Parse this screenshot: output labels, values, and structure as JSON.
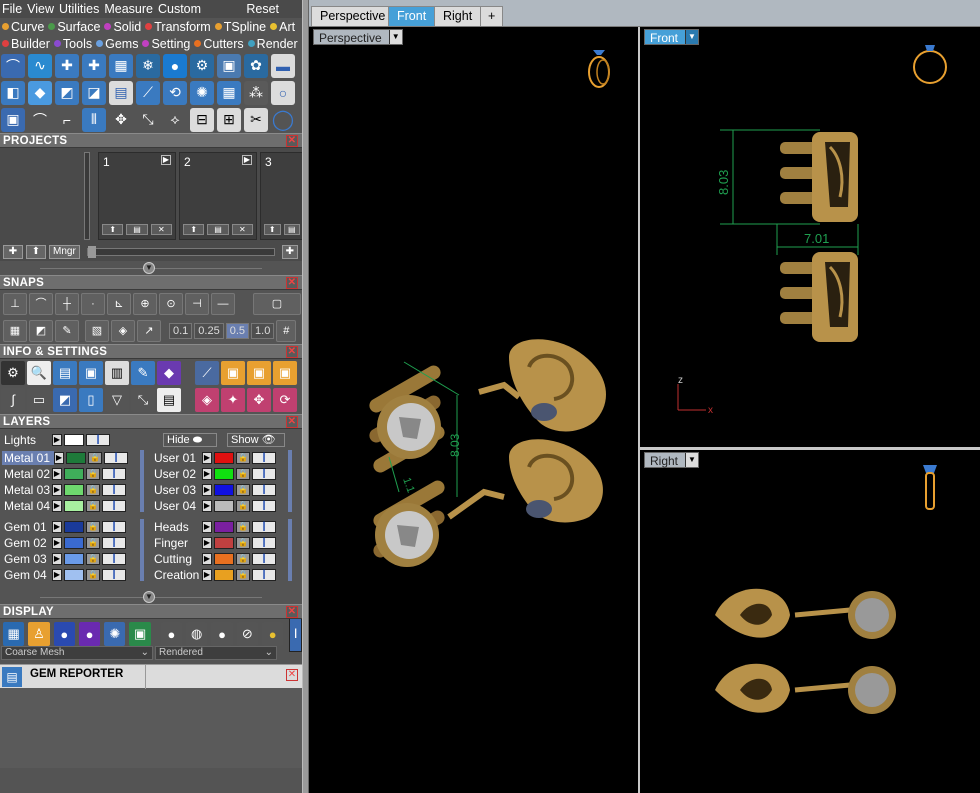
{
  "menu": {
    "items": [
      "File",
      "View",
      "Utilities",
      "Measure",
      "Custom"
    ],
    "reset": "Reset"
  },
  "plugins": {
    "row1": [
      {
        "label": "Curve",
        "color": "#e8a030"
      },
      {
        "label": "Surface",
        "color": "#4a9a4a"
      },
      {
        "label": "Solid",
        "color": "#c040c0"
      },
      {
        "label": "Transform",
        "color": "#e04040"
      },
      {
        "label": "TSpline",
        "color": "#e8a030"
      },
      {
        "label": "Art",
        "color": "#e8c030"
      }
    ],
    "row2": [
      {
        "label": "Builder",
        "color": "#e04040"
      },
      {
        "label": "Tools",
        "color": "#8a4ad0"
      },
      {
        "label": "Gems",
        "color": "#6aa0e0"
      },
      {
        "label": "Setting",
        "color": "#c040c0"
      },
      {
        "label": "Cutters",
        "color": "#e87020"
      },
      {
        "label": "Render",
        "color": "#40a0c0"
      }
    ]
  },
  "panels": {
    "projects": "PROJECTS",
    "snaps": "SNAPS",
    "info": "INFO & SETTINGS",
    "layers": "LAYERS",
    "display": "DISPLAY",
    "gem_reporter": "GEM REPORTER"
  },
  "projects": {
    "slots": [
      "1",
      "2",
      "3"
    ],
    "manager": "Mngr"
  },
  "snaps": {
    "values": [
      "0.1",
      "0.25",
      "0.5",
      "1.0"
    ],
    "selected": "0.5"
  },
  "layers": {
    "lights": "Lights",
    "hide": "Hide",
    "show": "Show",
    "left": [
      {
        "name": "Metal 01",
        "color": "#1e7a3a"
      },
      {
        "name": "Metal 02",
        "color": "#3fae5a"
      },
      {
        "name": "Metal 03",
        "color": "#6ed86e"
      },
      {
        "name": "Metal 04",
        "color": "#a8f0a0"
      },
      {
        "name": "Gem 01",
        "color": "#1a3a9a"
      },
      {
        "name": "Gem 02",
        "color": "#3a6ad0"
      },
      {
        "name": "Gem 03",
        "color": "#6a9ae8"
      },
      {
        "name": "Gem 04",
        "color": "#a0c0f0"
      }
    ],
    "right": [
      {
        "name": "User 01",
        "color": "#e01010"
      },
      {
        "name": "User 02",
        "color": "#10e010"
      },
      {
        "name": "User 03",
        "color": "#1010e0"
      },
      {
        "name": "User 04",
        "color": "#bbbbbb"
      },
      {
        "name": "Heads",
        "color": "#7a20a0"
      },
      {
        "name": "Finger",
        "color": "#c04040"
      },
      {
        "name": "Cutting",
        "color": "#e87020"
      },
      {
        "name": "Creation",
        "color": "#e8a020"
      }
    ]
  },
  "display": {
    "mesh": "Coarse Mesh",
    "mode": "Rendered"
  },
  "tabs": [
    {
      "label": "Perspective",
      "active": false
    },
    {
      "label": "Front",
      "active": true
    },
    {
      "label": "Right",
      "active": false
    },
    {
      "label": "+",
      "active": false
    }
  ],
  "viewports": {
    "perspective": {
      "label": "Perspective",
      "dims": [
        "8.03",
        "1.1"
      ]
    },
    "front": {
      "label": "Front",
      "dims": [
        "8.03",
        "7.01"
      ],
      "axis_z": "z",
      "axis_x": "x"
    },
    "right": {
      "label": "Right"
    }
  },
  "colors": {
    "gold": "#b8924a",
    "active_tab": "#46a0d8",
    "dim_green": "#1fa050"
  }
}
